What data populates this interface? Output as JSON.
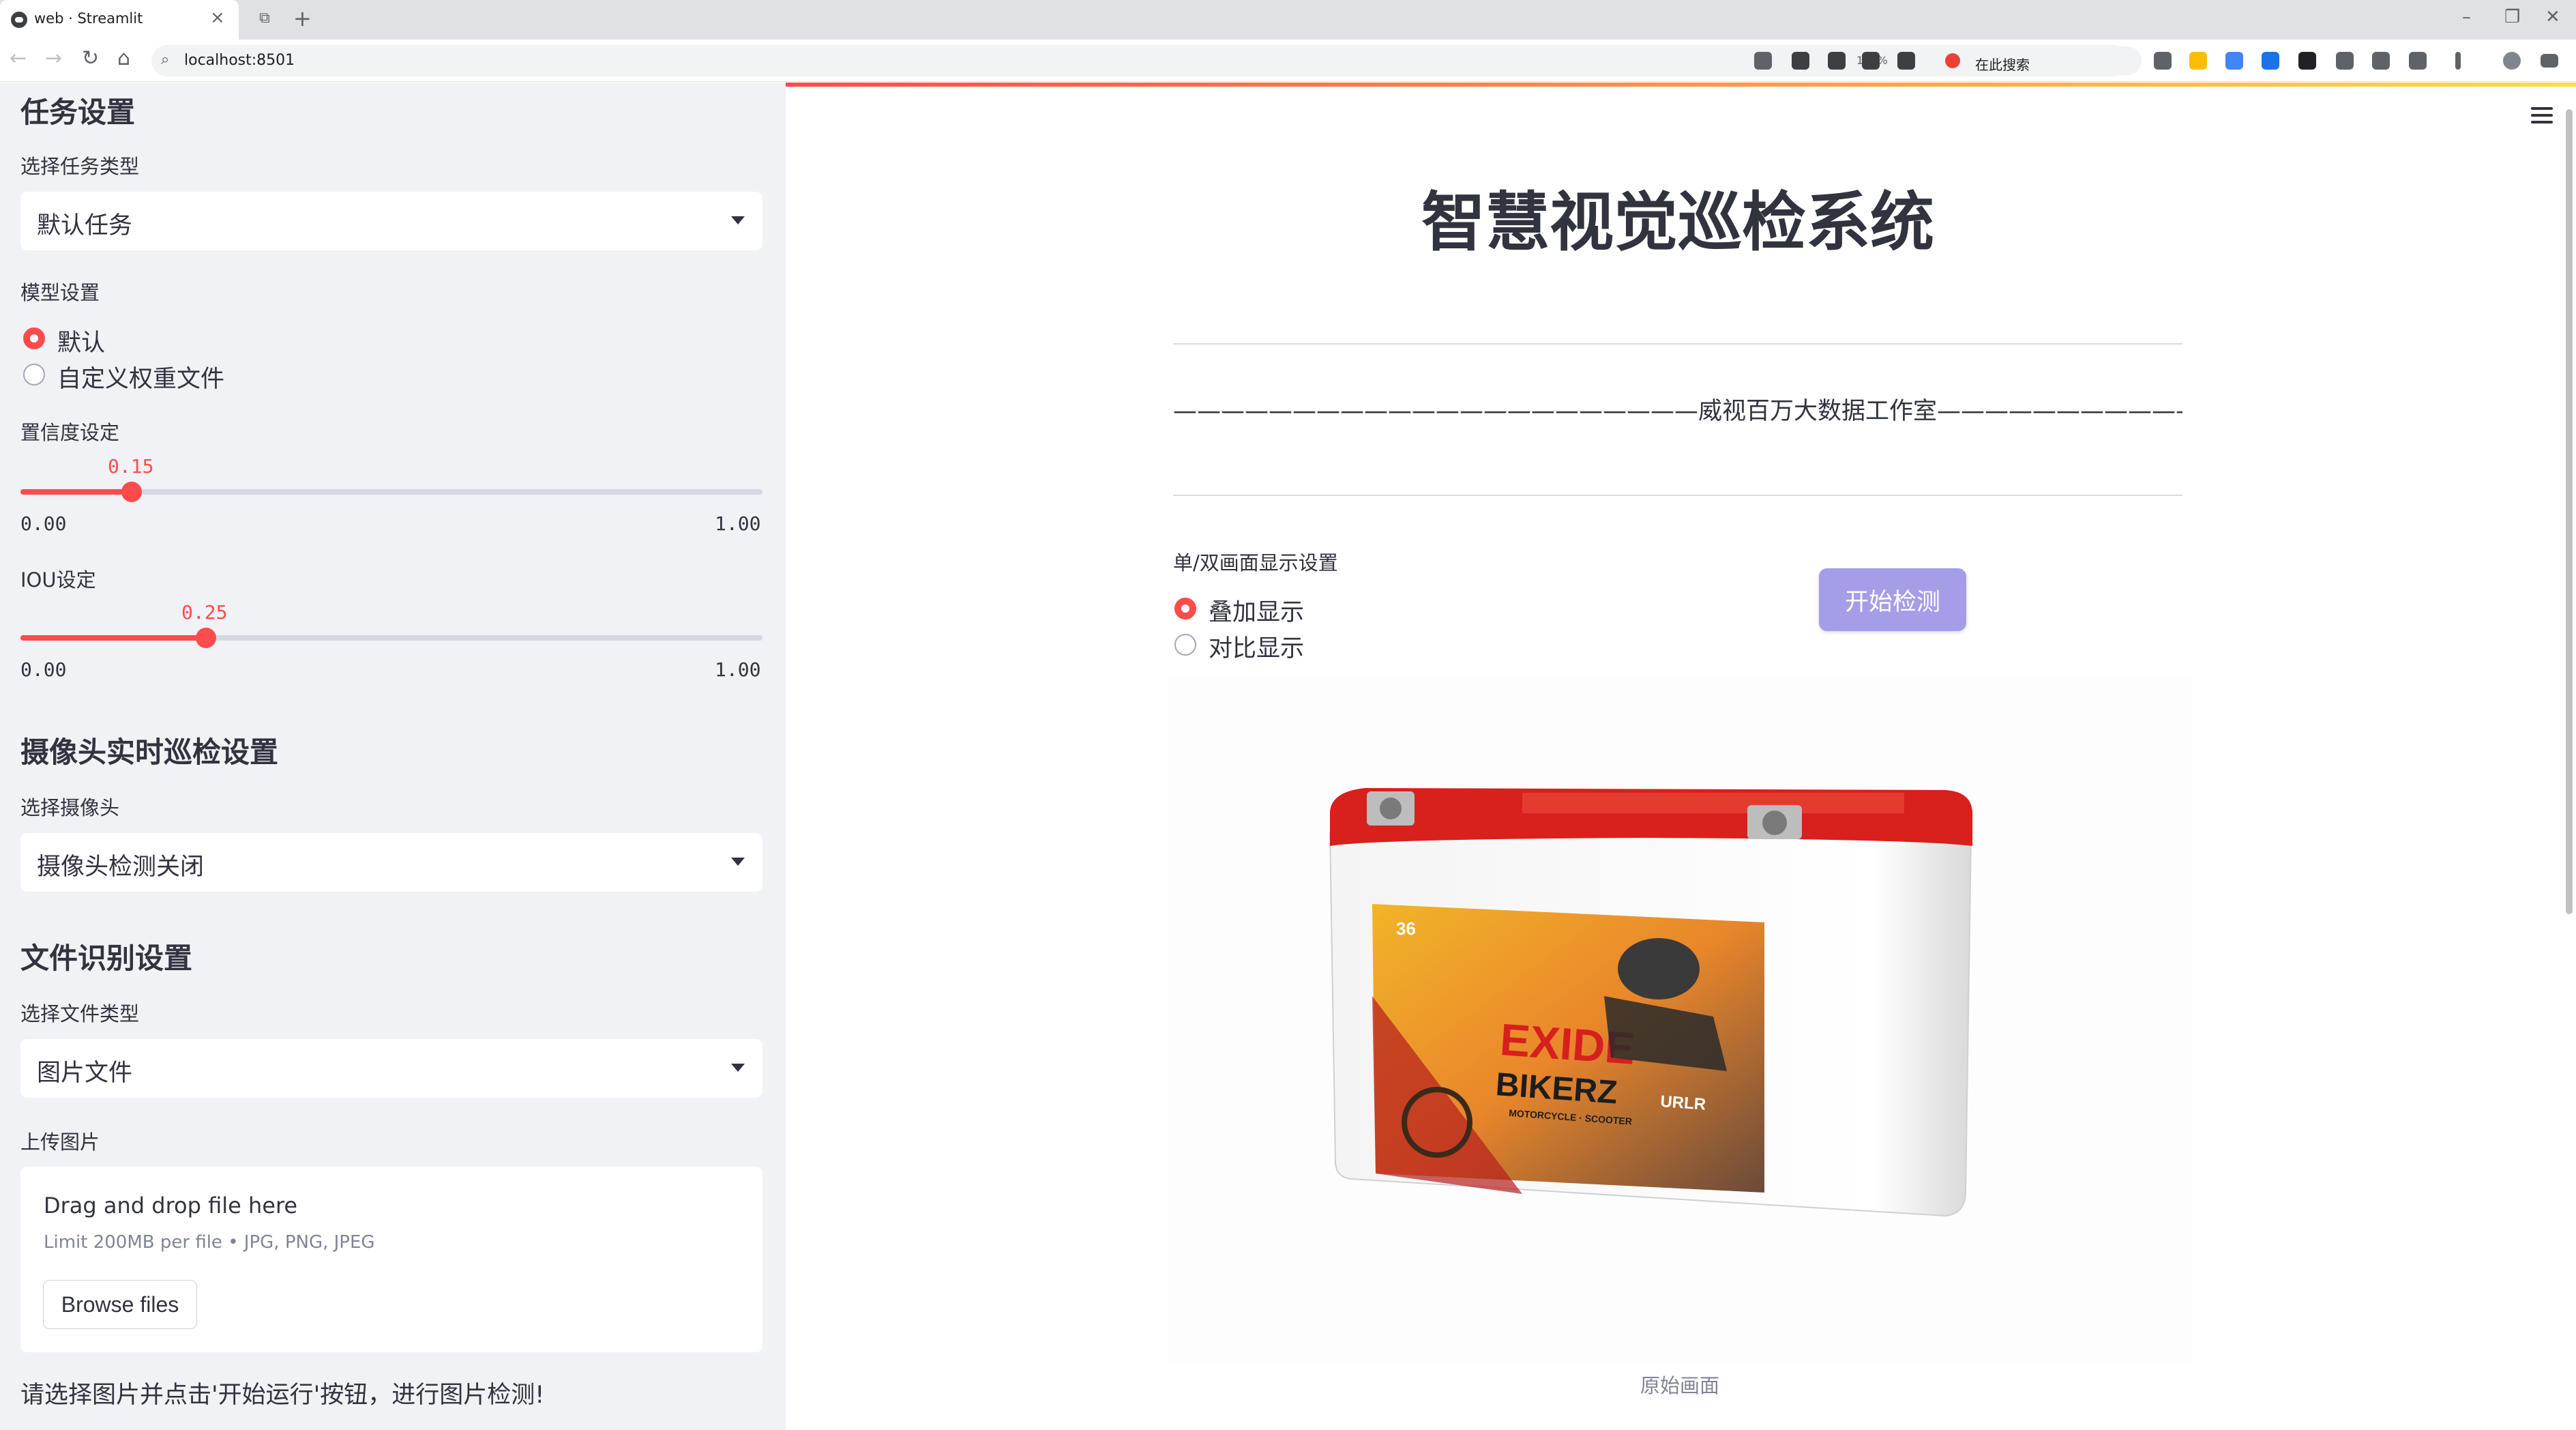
{
  "browser": {
    "tab_title": "web · Streamlit",
    "url": "localhost:8501",
    "zoom": "140%",
    "search_placeholder": "在此搜索"
  },
  "sidebar": {
    "task_section": {
      "heading": "任务设置",
      "select_label": "选择任务类型",
      "selected": "默认任务"
    },
    "model_section": {
      "label": "模型设置",
      "options": [
        "默认",
        "自定义权重文件"
      ],
      "selected_index": 0
    },
    "confidence": {
      "label": "置信度设定",
      "value": "0.15",
      "fraction": 0.15,
      "min": "0.00",
      "max": "1.00"
    },
    "iou": {
      "label": "IOU设定",
      "value": "0.25",
      "fraction": 0.25,
      "min": "0.00",
      "max": "1.00"
    },
    "camera_section": {
      "heading": "摄像头实时巡检设置",
      "select_label": "选择摄像头",
      "selected": "摄像头检测关闭"
    },
    "file_section": {
      "heading": "文件识别设置",
      "select_label": "选择文件类型",
      "selected": "图片文件",
      "upload_label": "上传图片",
      "drop_text": "Drag and drop file here",
      "limit_text": "Limit 200MB per file • JPG, PNG, JPEG",
      "browse_label": "Browse files"
    },
    "hint": "请选择图片并点击'开始运行'按钮，进行图片检测!"
  },
  "main": {
    "title": "智慧视觉巡检系统",
    "subtitle": "——————————————————————威视百万大数据工作室——————————————————————",
    "display_setting": {
      "label": "单/双画面显示设置",
      "options": [
        "叠加显示",
        "对比显示"
      ],
      "selected_index": 0
    },
    "start_button": "开始检测",
    "image": {
      "brand": "EXIDE",
      "product": "BIKERZ",
      "tagline": "MOTORCYCLE · SCOOTER",
      "badge": "36",
      "side_label": "URLR"
    },
    "caption": "原始画面"
  },
  "colors": {
    "accent": "#ff4b4b",
    "sidebar_bg": "#f0f2f6",
    "button_disabled": "#a49ee8",
    "text": "#31333f"
  }
}
